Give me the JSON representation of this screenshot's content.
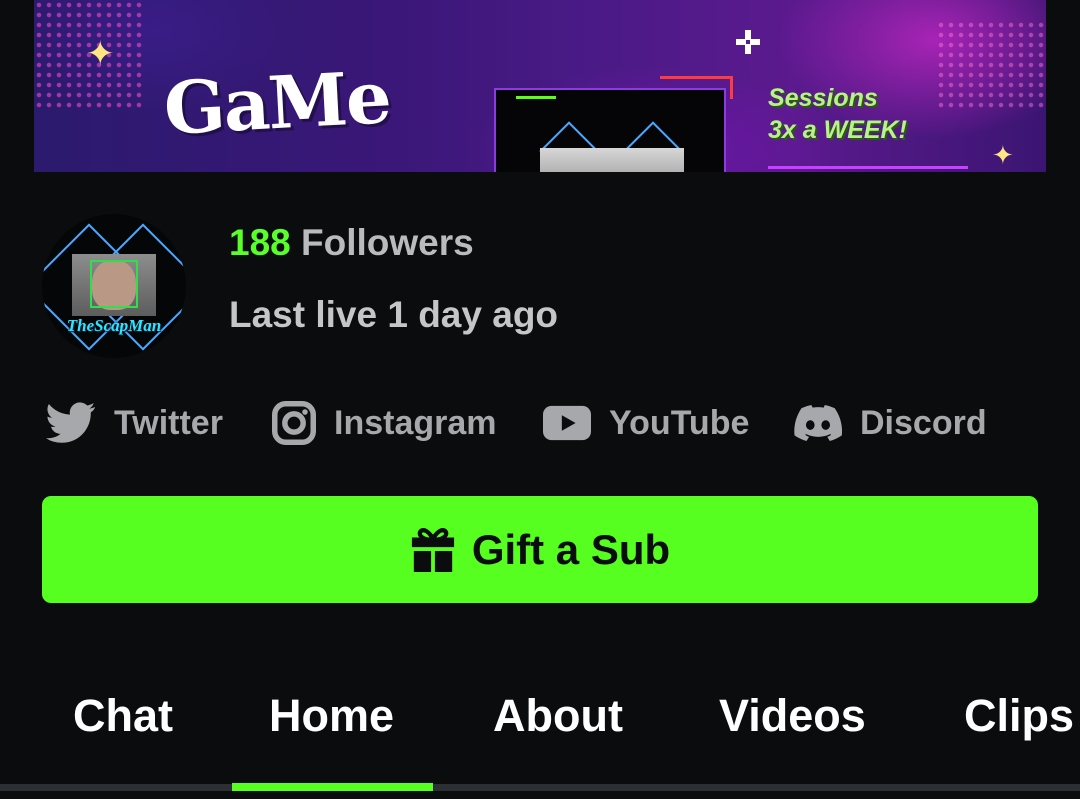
{
  "banner": {
    "logo_text": "GaMe",
    "promo_line1": "Sessions",
    "promo_line2": "3x a WEEK!"
  },
  "channel": {
    "avatar_name": "TheScapMan",
    "followers_count": "188",
    "followers_label": "Followers",
    "last_live": "Last live 1 day ago"
  },
  "social_links": [
    {
      "label": "Twitter",
      "icon": "twitter-icon"
    },
    {
      "label": "Instagram",
      "icon": "instagram-icon"
    },
    {
      "label": "YouTube",
      "icon": "youtube-icon"
    },
    {
      "label": "Discord",
      "icon": "discord-icon"
    }
  ],
  "gift_button": {
    "label": "Gift a Sub",
    "icon": "gift-icon"
  },
  "tabs": [
    {
      "label": "Chat"
    },
    {
      "label": "Home",
      "active": true
    },
    {
      "label": "About"
    },
    {
      "label": "Videos"
    },
    {
      "label": "Clips"
    }
  ],
  "colors": {
    "accent": "#56ff1f",
    "background": "#0b0c0d",
    "muted_text": "#a6a8ab"
  }
}
